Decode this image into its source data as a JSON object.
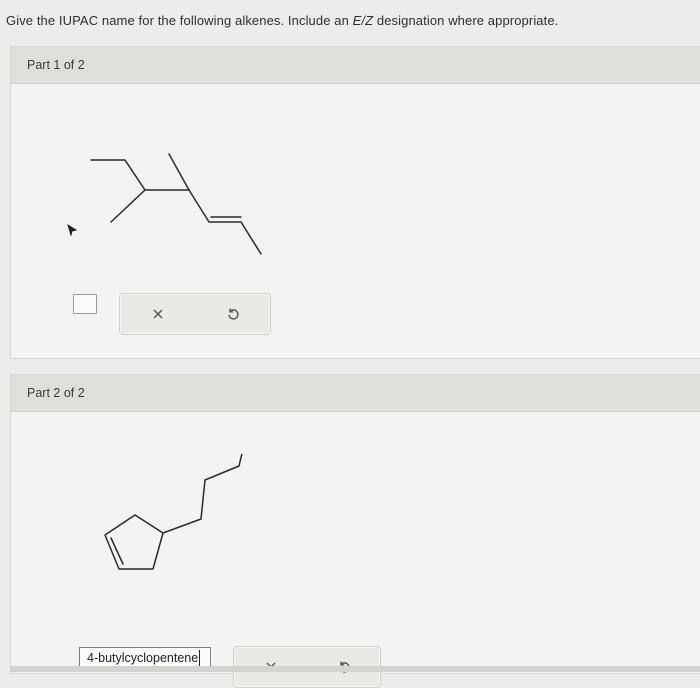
{
  "question": {
    "prefix": "Give the IUPAC name for the following alkenes. Include an ",
    "ez": "E/Z",
    "suffix": " designation where appropriate."
  },
  "parts": [
    {
      "header": "Part 1 of 2",
      "answer_value": "",
      "buttons": {
        "clear": "×",
        "reset": "↻"
      }
    },
    {
      "header": "Part 2 of 2",
      "answer_value": "4-butylcyclopentene",
      "buttons": {
        "clear": "×",
        "reset": "↻"
      }
    }
  ],
  "icons": {
    "clear": "close-icon",
    "reset": "undo-icon",
    "pointer": "cursor-icon"
  }
}
